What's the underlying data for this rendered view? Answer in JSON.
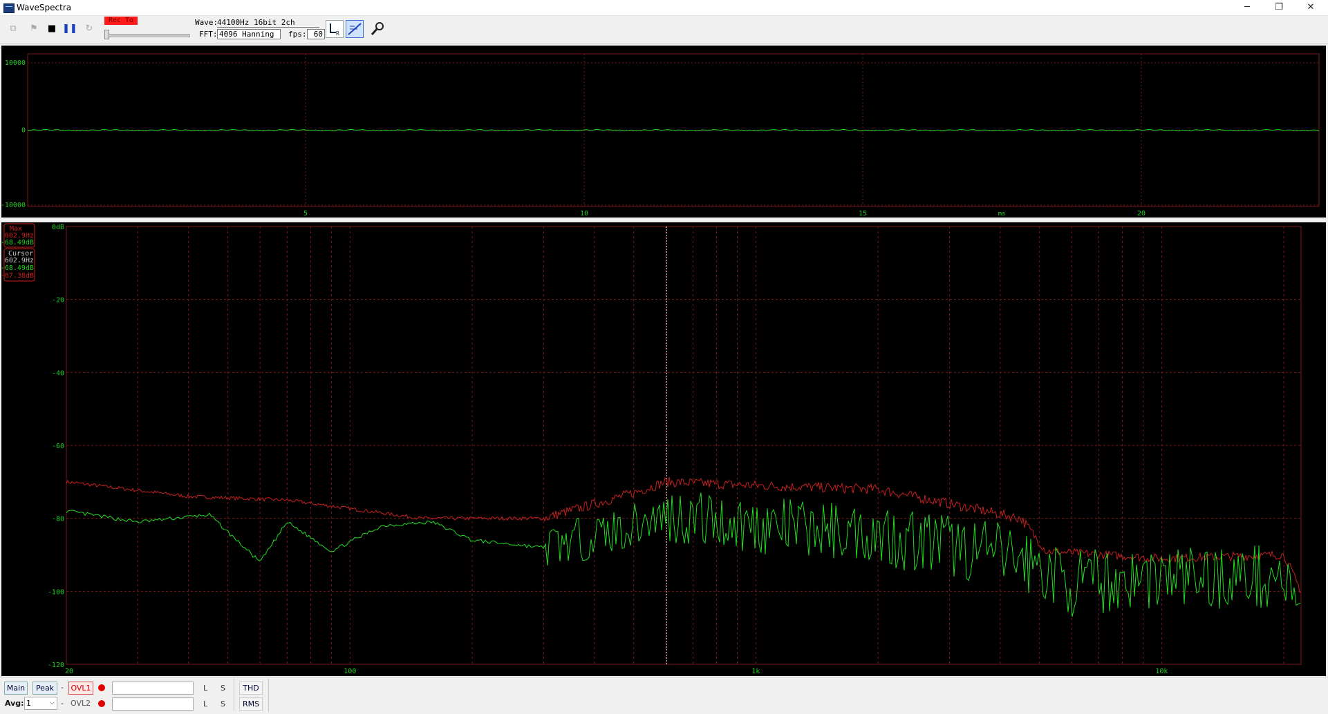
{
  "window": {
    "title": "WaveSpectra",
    "minimize": "─",
    "restore": "❐",
    "close": "✕"
  },
  "toolbar": {
    "rec_label": "Rec To",
    "wave_label": "Wave:",
    "wave_value": "44100Hz 16bit 2ch",
    "fft_label": "FFT:",
    "fft_value": "4096 Hanning",
    "fps_label": "fps:",
    "fps_value": "60",
    "icons": [
      "copy-icon",
      "play-icon",
      "stop-icon",
      "pause-icon",
      "reload-icon",
      "channel-lr-icon",
      "scale-icon",
      "settings-icon"
    ]
  },
  "wave_plot": {
    "y_ticks": [
      "10000",
      "0",
      "-10000"
    ],
    "x_ticks": [
      "5",
      "10",
      "15",
      "20"
    ],
    "x_unit": "ms"
  },
  "spectrum_plot": {
    "y_ticks": [
      "0dB",
      "-20",
      "-40",
      "-60",
      "-80",
      "-100",
      "-120"
    ],
    "x_ticks": [
      "20",
      "100",
      "1k",
      "10k"
    ],
    "max_box": {
      "title": "Max",
      "freq": "602.9Hz",
      "level": "-68.49dB"
    },
    "cursor_box": {
      "title": "Cursor",
      "freq": "602.9Hz",
      "level_l": "-68.49dB",
      "level_r": "-67.38dB"
    }
  },
  "status": {
    "main": "Main",
    "peak": "Peak",
    "ovl1": "OVL1",
    "ovl2": "OVL2",
    "avg_label": "Avg:",
    "avg_value": "1",
    "l1": "L",
    "s1": "S",
    "l2": "L",
    "s2": "S",
    "thd": "THD",
    "rms": "RMS",
    "dash": "-"
  },
  "colors": {
    "grid": "#7a1818",
    "trace_green": "#22dd22",
    "trace_red": "#c82020",
    "label_green": "#22cc22",
    "rec": "#ff1a1a"
  }
}
